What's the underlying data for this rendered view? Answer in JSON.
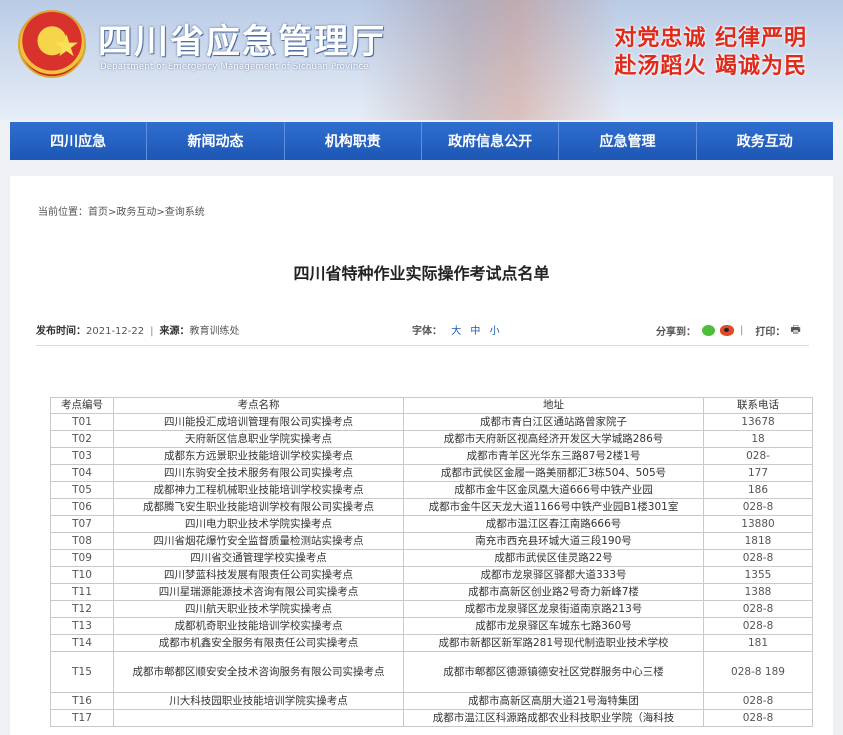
{
  "header": {
    "site_name": "四川省应急管理厅",
    "site_name_en": "Department of Emergency Management of Sichuan Province",
    "slogan_line1": "对党忠诚  纪律严明",
    "slogan_line2": "赴汤蹈火  竭诚为民"
  },
  "nav": [
    {
      "label": "四川应急"
    },
    {
      "label": "新闻动态"
    },
    {
      "label": "机构职责"
    },
    {
      "label": "政府信息公开"
    },
    {
      "label": "应急管理"
    },
    {
      "label": "政务互动"
    }
  ],
  "breadcrumb": {
    "prefix": "当前位置：",
    "items": [
      "首页",
      "政务互动",
      "查询系统"
    ],
    "separator": ">"
  },
  "article": {
    "title": "四川省特种作业实际操作考试点名单",
    "publish_label": "发布时间：",
    "publish_date": "2021-12-22",
    "divider": "|",
    "source_label": "来源：",
    "source": "教育训练处",
    "font_label": "字体：",
    "font_large": "大",
    "font_medium": "中",
    "font_small": "小",
    "share_label": "分享到：",
    "print_label": "打印："
  },
  "table": {
    "headers": [
      "考点编号",
      "考点名称",
      "地址",
      "联系电话"
    ],
    "rows": [
      {
        "id": "T01",
        "name": "四川能投汇成培训管理有限公司实操考点",
        "address": "成都市青白江区通站路曾家院子",
        "phone": "13678"
      },
      {
        "id": "T02",
        "name": "天府新区信息职业学院实操考点",
        "address": "成都市天府新区视高经济开发区大学城路286号",
        "phone": "18"
      },
      {
        "id": "T03",
        "name": "成都东方远景职业技能培训学校实操考点",
        "address": "成都市青羊区光华东三路87号2楼1号",
        "phone": "028-"
      },
      {
        "id": "T04",
        "name": "四川东驹安全技术服务有限公司实操考点",
        "address": "成都市武侯区金履一路美丽都汇3栋504、505号",
        "phone": "177"
      },
      {
        "id": "T05",
        "name": "成都神力工程机械职业技能培训学校实操考点",
        "address": "成都市金牛区金凤凰大道666号中铁产业园",
        "phone": "186"
      },
      {
        "id": "T06",
        "name": "成都腾飞安生职业技能培训学校有限公司实操考点",
        "address": "成都市金牛区天龙大道1166号中铁产业园B1楼301室",
        "phone": "028-8"
      },
      {
        "id": "T07",
        "name": "四川电力职业技术学院实操考点",
        "address": "成都市温江区春江南路666号",
        "phone": "13880"
      },
      {
        "id": "T08",
        "name": "四川省烟花爆竹安全监督质量检测站实操考点",
        "address": "南充市西充县环城大道三段190号",
        "phone": "1818"
      },
      {
        "id": "T09",
        "name": "四川省交通管理学校实操考点",
        "address": "成都市武侯区佳灵路22号",
        "phone": "028-8"
      },
      {
        "id": "T10",
        "name": "四川梦蓝科技发展有限责任公司实操考点",
        "address": "成都市龙泉驿区驿都大道333号",
        "phone": "1355"
      },
      {
        "id": "T11",
        "name": "四川星瑞源能源技术咨询有限公司实操考点",
        "address": "成都市高新区创业路2号奇力新峰7楼",
        "phone": "1388"
      },
      {
        "id": "T12",
        "name": "四川航天职业技术学院实操考点",
        "address": "成都市龙泉驿区龙泉街道南京路213号",
        "phone": "028-8"
      },
      {
        "id": "T13",
        "name": "成都机奇职业技能培训学校实操考点",
        "address": "成都市龙泉驿区车城东七路360号",
        "phone": "028-8"
      },
      {
        "id": "T14",
        "name": "成都市机鑫安全服务有限责任公司实操考点",
        "address": "成都市新都区新军路281号现代制造职业技术学校",
        "phone": "181"
      },
      {
        "id": "T15",
        "name": "成都市郫都区顺安安全技术咨询服务有限公司实操考点",
        "address": "成都市郫都区德源镇德安社区党群服务中心三楼",
        "phone": "028-8  189"
      },
      {
        "id": "T16",
        "name": "川大科技园职业技能培训学院实操考点",
        "address": "成都市高新区高朋大道21号海特集团",
        "phone": "028-8"
      },
      {
        "id": "T17",
        "name": "",
        "address": "成都市温江区科源路成都农业科技职业学院（海科技",
        "phone": "028-8"
      }
    ]
  }
}
